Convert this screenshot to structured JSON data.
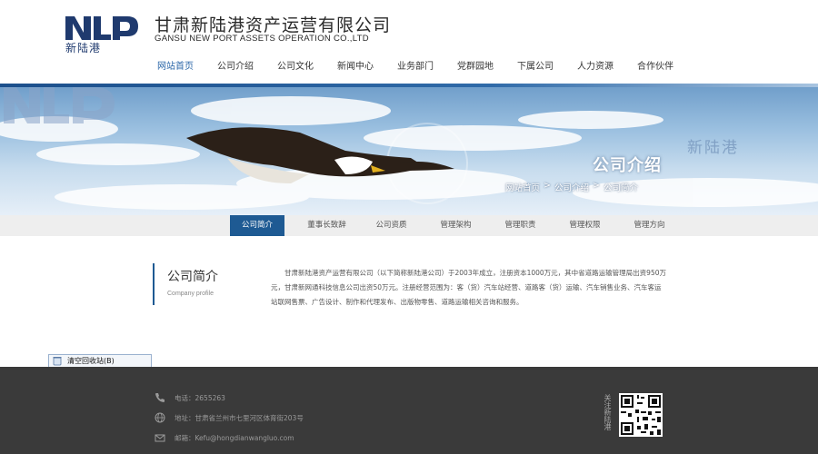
{
  "header": {
    "logo_sub": "新陆港",
    "company_cn": "甘肃新陆港资产运营有限公司",
    "company_en": "GANSU NEW PORT ASSETS OPERATION CO.,LTD"
  },
  "nav": {
    "items": [
      "网站首页",
      "公司介绍",
      "公司文化",
      "新闻中心",
      "业务部门",
      "党群园地",
      "下属公司",
      "人力资源",
      "合作伙伴"
    ],
    "active_index": 0
  },
  "banner": {
    "title": "公司介绍",
    "watermark": "新陆港",
    "breadcrumb": [
      "网站首页",
      "公司介绍",
      "公司简介"
    ],
    "breadcrumb_sep": ">"
  },
  "subnav": {
    "items": [
      "公司简介",
      "董事长致辞",
      "公司资质",
      "管理架构",
      "管理职责",
      "管理权限",
      "管理方向"
    ],
    "active_index": 0
  },
  "aside": {
    "title": "公司简介",
    "subtitle": "Company profile"
  },
  "content": {
    "paragraph_1": "甘肃新陆港资产运营有限公司（以下简称新陆港公司）于2003年成立，注册资本1000万元，其中省道路运输管理局出资950万元，甘肃新网通科技信息公司出资50万元。注册经营范围为：客（货）汽车站经营、道路客（货）运输、汽车销售业务、汽车客运站联网售票、广告设计、制作和代理发布、出版物零售、道路运输相关咨询和服务。"
  },
  "tooltip": {
    "label": "清空回收站(B)"
  },
  "footer": {
    "phone": "电话：2655263",
    "address": "地址：甘肃省兰州市七里河区体育街203号",
    "email": "邮箱：Kefu@hongdianwangluo.com",
    "qr_label": "关注新陆港"
  },
  "colors": {
    "accent": "#1e5a93",
    "nav_active": "#2b67a8",
    "footer_bg": "#3a3a3a"
  }
}
